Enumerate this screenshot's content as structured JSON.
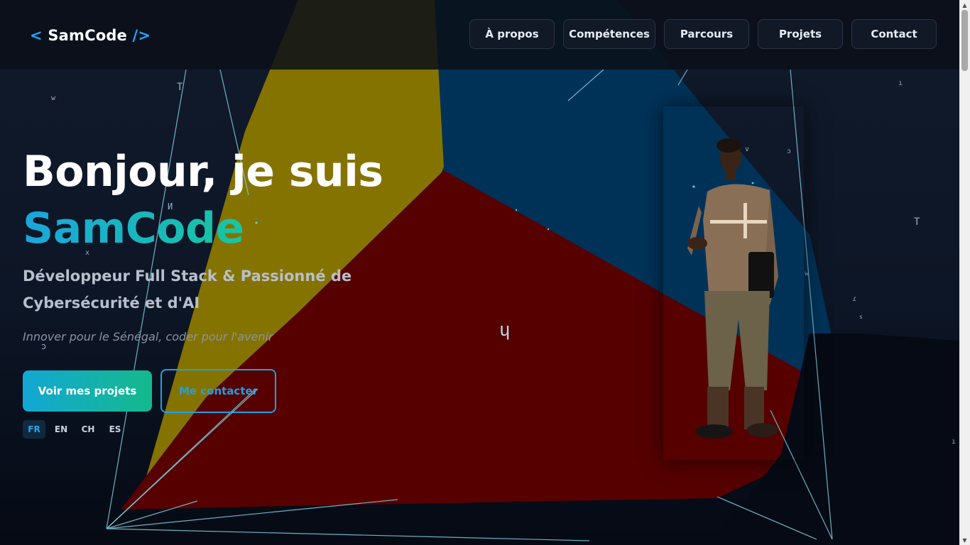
{
  "header": {
    "logo": {
      "open": "< ",
      "name": "SamCode",
      "close": " />"
    },
    "nav": [
      {
        "id": "about",
        "label": "À propos"
      },
      {
        "id": "skills",
        "label": "Compétences"
      },
      {
        "id": "journey",
        "label": "Parcours"
      },
      {
        "id": "projects",
        "label": "Projets"
      },
      {
        "id": "contact",
        "label": "Contact"
      }
    ]
  },
  "hero": {
    "title_line1": "Bonjour, je suis",
    "title_line2": "SamCode",
    "subtitle": "Développeur Full Stack & Passionné de Cybersécurité et d'AI",
    "tagline": "Innover pour le Sénégal, coder pour l'avenir",
    "cta_primary": "Voir mes projets",
    "cta_secondary": "Me contacter",
    "languages": [
      {
        "code": "FR",
        "active": true
      },
      {
        "code": "EN",
        "active": false
      },
      {
        "code": "CH",
        "active": false
      },
      {
        "code": "ES",
        "active": false
      }
    ]
  },
  "floating_glyphs": [
    "w",
    "T",
    "И",
    "x",
    "ɔ",
    "ɥ",
    "T",
    "v",
    "ɔ",
    "ı",
    "w",
    "ɾ",
    "s",
    "ı",
    "ɥ"
  ],
  "colors": {
    "accent_blue": "#1ea7ff",
    "gradient_start": "#13a7d4",
    "gradient_end": "#14b98c",
    "shape_yellow": "#857300",
    "shape_red": "#560000",
    "shape_blue": "#003258"
  }
}
